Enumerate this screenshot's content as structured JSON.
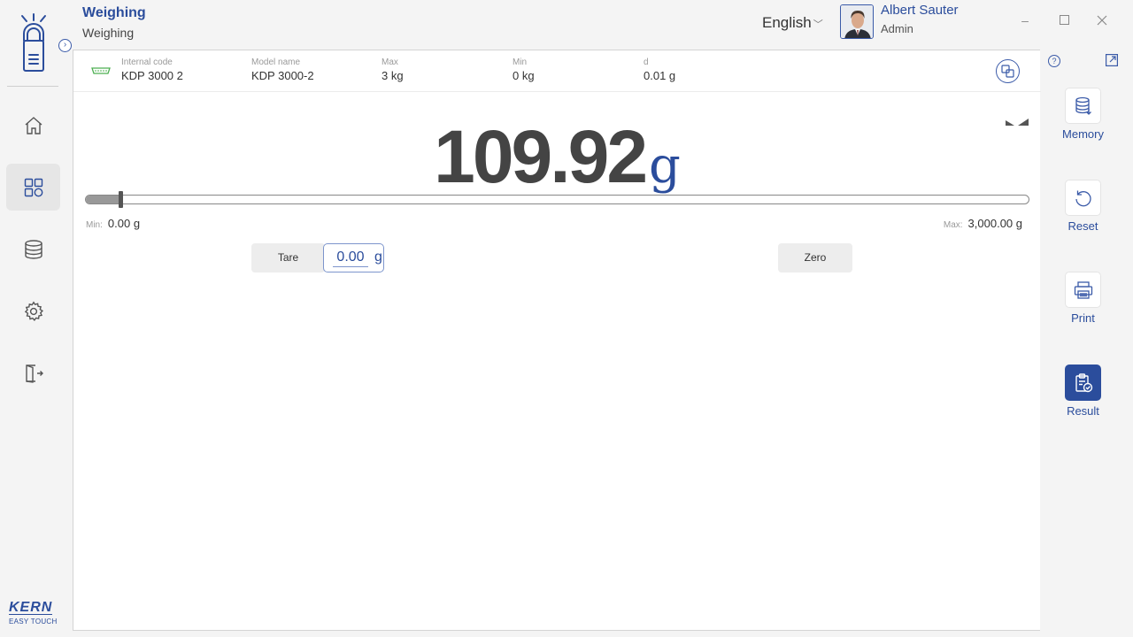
{
  "header": {
    "title": "Weighing",
    "subtitle": "Weighing",
    "language": "English",
    "user_name": "Albert Sauter",
    "user_role": "Admin"
  },
  "brand": {
    "name": "KERN",
    "tagline": "EASY TOUCH"
  },
  "nav": [
    {
      "name": "home",
      "icon": "home-icon",
      "active": false
    },
    {
      "name": "applications",
      "icon": "grid-icon",
      "active": true
    },
    {
      "name": "database",
      "icon": "database-icon",
      "active": false
    },
    {
      "name": "settings",
      "icon": "gear-icon",
      "active": false
    },
    {
      "name": "logout",
      "icon": "exit-icon",
      "active": false
    }
  ],
  "balance_info": {
    "internal_code_label": "Internal code",
    "internal_code": "KDP 3000 2",
    "model_name_label": "Model name",
    "model_name": "KDP 3000-2",
    "max_label": "Max",
    "max": "3 kg",
    "min_label": "Min",
    "min": "0 kg",
    "d_label": "d",
    "d": "0.01 g"
  },
  "display": {
    "value": "109.92",
    "unit": "g",
    "capacity_fraction": 0.037
  },
  "range": {
    "min_label": "Min:",
    "min_value": "0.00 g",
    "max_label": "Max:",
    "max_value": "3,000.00 g"
  },
  "controls": {
    "tare_label": "Tare",
    "tare_value": "0.00",
    "tare_unit": "g",
    "zero_label": "Zero"
  },
  "side_actions": {
    "memory": "Memory",
    "reset": "Reset",
    "print": "Print",
    "result": "Result"
  },
  "colors": {
    "accent": "#2b4d9c",
    "background": "#f4f4f4",
    "panel": "#ffffff"
  }
}
